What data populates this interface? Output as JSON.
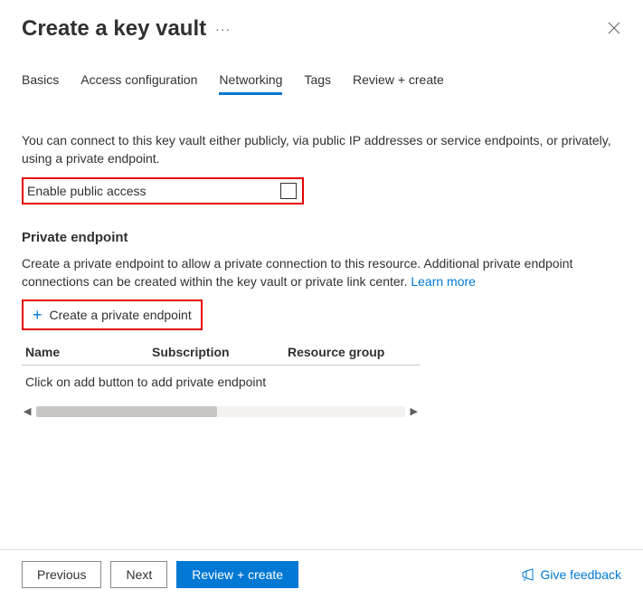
{
  "header": {
    "title": "Create a key vault",
    "ellipsis": "···"
  },
  "tabs": {
    "basics": "Basics",
    "access": "Access configuration",
    "networking": "Networking",
    "tags": "Tags",
    "review": "Review + create"
  },
  "networking": {
    "description": "You can connect to this key vault either publicly, via public IP addresses or service endpoints, or privately, using a private endpoint.",
    "enable_public_label": "Enable public access",
    "private_endpoint": {
      "heading": "Private endpoint",
      "description": "Create a private endpoint to allow a private connection to this resource. Additional private endpoint connections can be created within the key vault or private link center.  ",
      "learn_more": "Learn more",
      "create_button": "Create a private endpoint",
      "columns": {
        "name": "Name",
        "subscription": "Subscription",
        "resource_group": "Resource group"
      },
      "empty_text": "Click on add button to add private endpoint"
    }
  },
  "footer": {
    "previous": "Previous",
    "next": "Next",
    "review": "Review + create",
    "feedback": "Give feedback"
  }
}
